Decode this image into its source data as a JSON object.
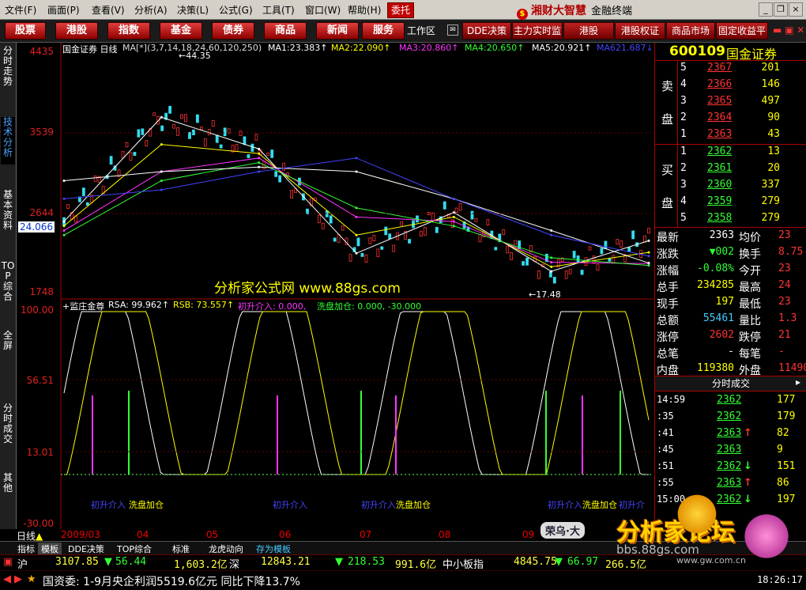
{
  "menu": [
    "文件(F)",
    "画面(P)",
    "查看(V)",
    "分析(A)",
    "决策(L)",
    "公式(G)",
    "工具(T)",
    "窗口(W)",
    "帮助(H)"
  ],
  "entrust": "委托",
  "brand": {
    "logo": "$",
    "name": "湘财大智慧",
    "sub": "金融终端"
  },
  "toolbar": {
    "buttons": [
      "股票",
      "港股",
      "指数",
      "基金",
      "债券",
      "商品",
      "新闻",
      "服务"
    ],
    "workarea": "工作区",
    "buttons2": [
      "DDE决策",
      "主力实时监",
      "港股",
      "港股权证",
      "商品市场",
      "固定收益平"
    ]
  },
  "lefttabs": [
    "分时走势",
    "技术分析",
    "基本资料",
    "TOP综合",
    "全屏",
    "分时成交",
    "其他"
  ],
  "chart": {
    "title": "国金证券 日线",
    "ma_params": "MA[*](3,7,14,18,24,60,120,250)",
    "ma": [
      {
        "label": "MA1:",
        "value": "23.383↑",
        "color": "#ffffff"
      },
      {
        "label": "MA2:",
        "value": "22.090↑",
        "color": "#ffff00"
      },
      {
        "label": "MA3:",
        "value": "20.860↑",
        "color": "#ff33ff"
      },
      {
        "label": "MA4:",
        "value": "20.650↑",
        "color": "#33ff33"
      },
      {
        "label": "MA5:",
        "value": "20.921↑",
        "color": "#ffffff"
      },
      {
        "label": "MA6",
        "value": "21.687↓",
        "color": "#4444ff"
      }
    ],
    "y_ticks": [
      "4435",
      "3539",
      "2644",
      "1748"
    ],
    "current_price": "24.066",
    "high_mark": "44.35",
    "low_mark": "17.48",
    "x_labels": [
      "2009/03",
      "04",
      "05",
      "06",
      "07",
      "08",
      "09"
    ],
    "timeframe": "日线",
    "watermark": "分析家公式网 www.88gs.com"
  },
  "indicator": {
    "name": "监庄金尊",
    "rsa": "RSA: 99.962↑",
    "rsb": "RSB: 73.557↑",
    "entry": "初升介入: 0.000,",
    "add": "洗盘加仓: 0.000, -30.000",
    "y_ticks": [
      "100.00",
      "56.51",
      "13.01",
      "-30.00"
    ],
    "annotations": [
      "初升介入",
      "洗盘加仓",
      "初升介入",
      "初升介入",
      "洗盘加仓",
      "初升介入",
      "洗盘加仓",
      "初升介"
    ]
  },
  "chart_data": {
    "type": "line",
    "title": "国金证券 日线",
    "xlabel": "",
    "ylabel": "",
    "x": [
      "2009/03",
      "04",
      "05",
      "06",
      "07",
      "08",
      "09"
    ],
    "ylim": [
      17.48,
      44.35
    ],
    "series": [
      {
        "name": "MA1",
        "values": [
          25.5,
          37.0,
          33.5,
          22.0,
          26.5,
          20.0,
          23.383
        ]
      },
      {
        "name": "MA2",
        "values": [
          25.0,
          34.0,
          33.0,
          24.0,
          26.0,
          20.5,
          22.09
        ]
      },
      {
        "name": "MA3",
        "values": [
          24.5,
          31.0,
          32.5,
          26.0,
          25.5,
          21.0,
          20.86
        ]
      },
      {
        "name": "MA4",
        "values": [
          24.0,
          30.0,
          32.0,
          27.0,
          25.0,
          21.5,
          20.65
        ]
      },
      {
        "name": "MA5",
        "values": [
          30.0,
          31.0,
          31.5,
          31.0,
          28.0,
          24.5,
          20.921
        ]
      },
      {
        "name": "MA6",
        "values": [
          28.0,
          29.0,
          31.0,
          32.5,
          28.0,
          24.0,
          21.687
        ]
      }
    ]
  },
  "right": {
    "code": "600109",
    "name": "国金证券",
    "sell_label": [
      "卖",
      "盘"
    ],
    "buy_label": [
      "买",
      "盘"
    ],
    "sell": [
      {
        "lvl": "5",
        "price": "2367",
        "vol": "201"
      },
      {
        "lvl": "4",
        "price": "2366",
        "vol": "146"
      },
      {
        "lvl": "3",
        "price": "2365",
        "vol": "497"
      },
      {
        "lvl": "2",
        "price": "2364",
        "vol": "90"
      },
      {
        "lvl": "1",
        "price": "2363",
        "vol": "43"
      }
    ],
    "buy": [
      {
        "lvl": "1",
        "price": "2362",
        "vol": "13"
      },
      {
        "lvl": "2",
        "price": "2361",
        "vol": "20"
      },
      {
        "lvl": "3",
        "price": "2360",
        "vol": "337"
      },
      {
        "lvl": "4",
        "price": "2359",
        "vol": "279"
      },
      {
        "lvl": "5",
        "price": "2358",
        "vol": "279"
      }
    ],
    "stats": [
      {
        "l": "最新",
        "v": "2363",
        "l2": "均价",
        "v2": "23"
      },
      {
        "l": "涨跌",
        "v": "▼002",
        "l2": "换手",
        "v2": "8.75"
      },
      {
        "l": "涨幅",
        "v": "-0.08%",
        "l2": "今开",
        "v2": "23"
      },
      {
        "l": "总手",
        "v": "234285",
        "l2": "最高",
        "v2": "24"
      },
      {
        "l": "现手",
        "v": "197",
        "l2": "最低",
        "v2": "23"
      },
      {
        "l": "总额",
        "v": "55461",
        "l2": "量比",
        "v2": "1.3"
      },
      {
        "l": "涨停",
        "v": "2602",
        "l2": "跌停",
        "v2": "21"
      },
      {
        "l": "总笔",
        "v": "-",
        "l2": "每笔",
        "v2": "-"
      },
      {
        "l": "内盘",
        "v": "119380",
        "l2": "外盘",
        "v2": "11490"
      }
    ],
    "tick_header": "分时成交",
    "ticks": [
      {
        "t": "14:59",
        "p": "2362",
        "a": "",
        "v": "177"
      },
      {
        "t": ":35",
        "p": "2362",
        "a": "",
        "v": "179"
      },
      {
        "t": ":41",
        "p": "2363",
        "a": "↑",
        "v": "82"
      },
      {
        "t": ":45",
        "p": "2363",
        "a": "",
        "v": "9"
      },
      {
        "t": ":51",
        "p": "2362",
        "a": "↓",
        "v": "151"
      },
      {
        "t": ":55",
        "p": "2363",
        "a": "↑",
        "v": "86"
      },
      {
        "t": "15:00",
        "p": "2362",
        "a": "↓",
        "v": "197"
      }
    ]
  },
  "bottomtabs": [
    "指标",
    "模板",
    "DDE决策",
    "TOP综合",
    "标准",
    "龙虎动向",
    "存为模板"
  ],
  "ticker": [
    {
      "k": "沪",
      "v": "3107.85",
      "c": "▼",
      "d": "56.44",
      "amt": "1,603.2亿"
    },
    {
      "k": "深",
      "v": "12843.21",
      "c": "▼",
      "d": "218.53",
      "amt": "991.6亿"
    },
    {
      "k": "中小板指",
      "v": "4845.75",
      "c": "▼",
      "d": "66.97",
      "amt": "266.5亿"
    }
  ],
  "news": "国资委: 1-9月央企利润5519.6亿元 同比下降13.7%",
  "time": "18:26:17",
  "watermarks": {
    "w1": "分析家论坛",
    "w2": "bbs.88gs.com",
    "w3": "www.gw.com.cn",
    "w4": "荣乌·大"
  }
}
